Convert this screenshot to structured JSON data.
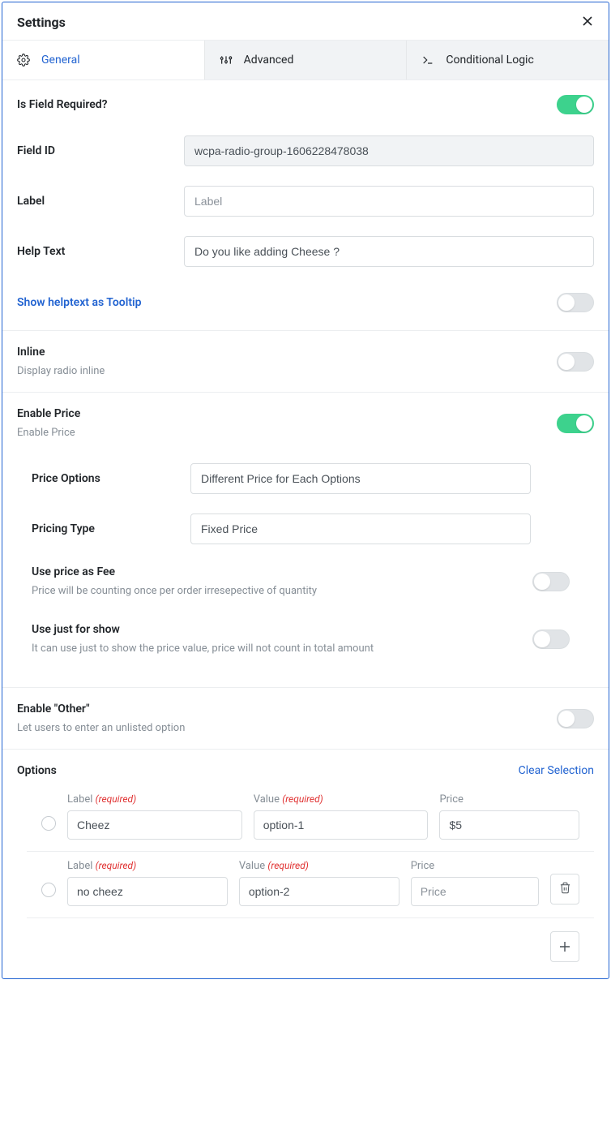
{
  "header": {
    "title": "Settings"
  },
  "tabs": {
    "general": "General",
    "advanced": "Advanced",
    "conditional": "Conditional Logic"
  },
  "labels": {
    "is_required": "Is Field Required?",
    "field_id": "Field ID",
    "label": "Label",
    "label_placeholder": "Label",
    "help_text": "Help Text",
    "show_tooltip": "Show helptext as Tooltip",
    "inline": "Inline",
    "inline_desc": "Display radio inline",
    "enable_price": "Enable Price",
    "enable_price_desc": "Enable Price",
    "price_options": "Price Options",
    "pricing_type": "Pricing Type",
    "use_as_fee": "Use price as Fee",
    "use_as_fee_desc": "Price will be counting once per order irresepective of quantity",
    "just_for_show": "Use just for show",
    "just_for_show_desc": "It can use just to show the price value, price will not count in total amount",
    "enable_other": "Enable \"Other\"",
    "enable_other_desc": "Let users to enter an unlisted option",
    "options": "Options",
    "clear_selection": "Clear Selection",
    "col_label": "Label",
    "col_value": "Value",
    "col_price": "Price",
    "required_tag": "(required)",
    "price_placeholder": "Price"
  },
  "values": {
    "field_id": "wcpa-radio-group-1606228478038",
    "help_text": "Do you like adding Cheese ?",
    "price_options": "Different Price for Each Options",
    "pricing_type": "Fixed Price"
  },
  "toggles": {
    "is_required": true,
    "tooltip": false,
    "inline": false,
    "enable_price": true,
    "use_as_fee": false,
    "just_for_show": false,
    "enable_other": false
  },
  "options": [
    {
      "label": "Cheez",
      "value": "option-1",
      "price": "$5",
      "deletable": false
    },
    {
      "label": "no cheez",
      "value": "option-2",
      "price": "",
      "deletable": true
    }
  ]
}
